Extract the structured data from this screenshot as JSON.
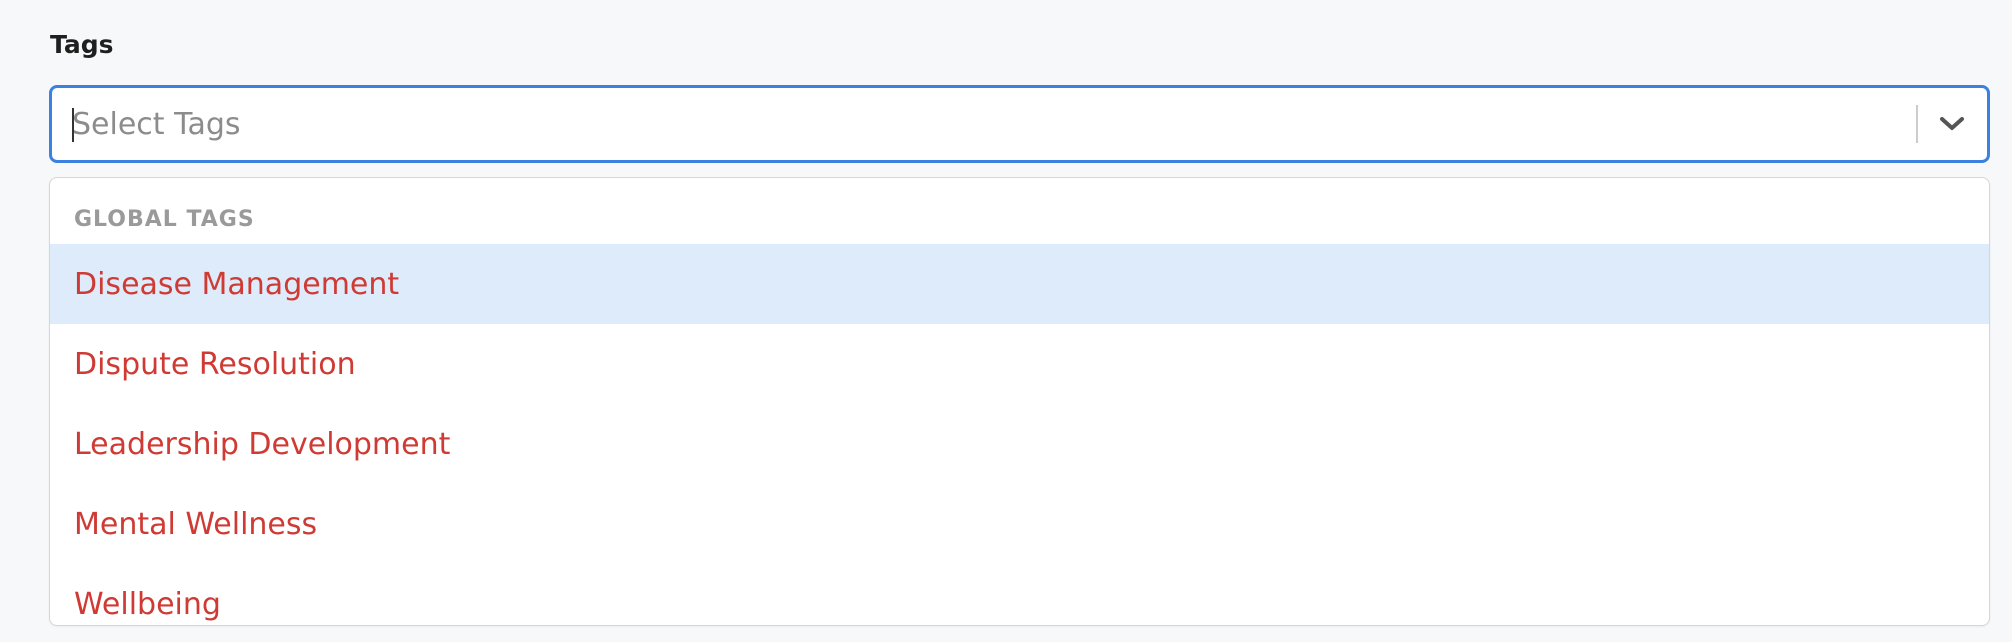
{
  "field": {
    "label": "Tags"
  },
  "select": {
    "placeholder": "Select Tags",
    "value": ""
  },
  "menu": {
    "group_heading": "GLOBAL TAGS",
    "options": [
      {
        "label": "Disease Management",
        "focused": true
      },
      {
        "label": "Dispute Resolution",
        "focused": false
      },
      {
        "label": "Leadership Development",
        "focused": false
      },
      {
        "label": "Mental Wellness",
        "focused": false
      },
      {
        "label": "Wellbeing",
        "focused": false
      }
    ]
  },
  "icons": {
    "dropdown": "chevron-down-icon"
  },
  "colors": {
    "focus_border": "#3b82e0",
    "option_text": "#cf3b34",
    "focused_option_bg": "#deebfb",
    "group_heading": "#9a9a9a"
  }
}
